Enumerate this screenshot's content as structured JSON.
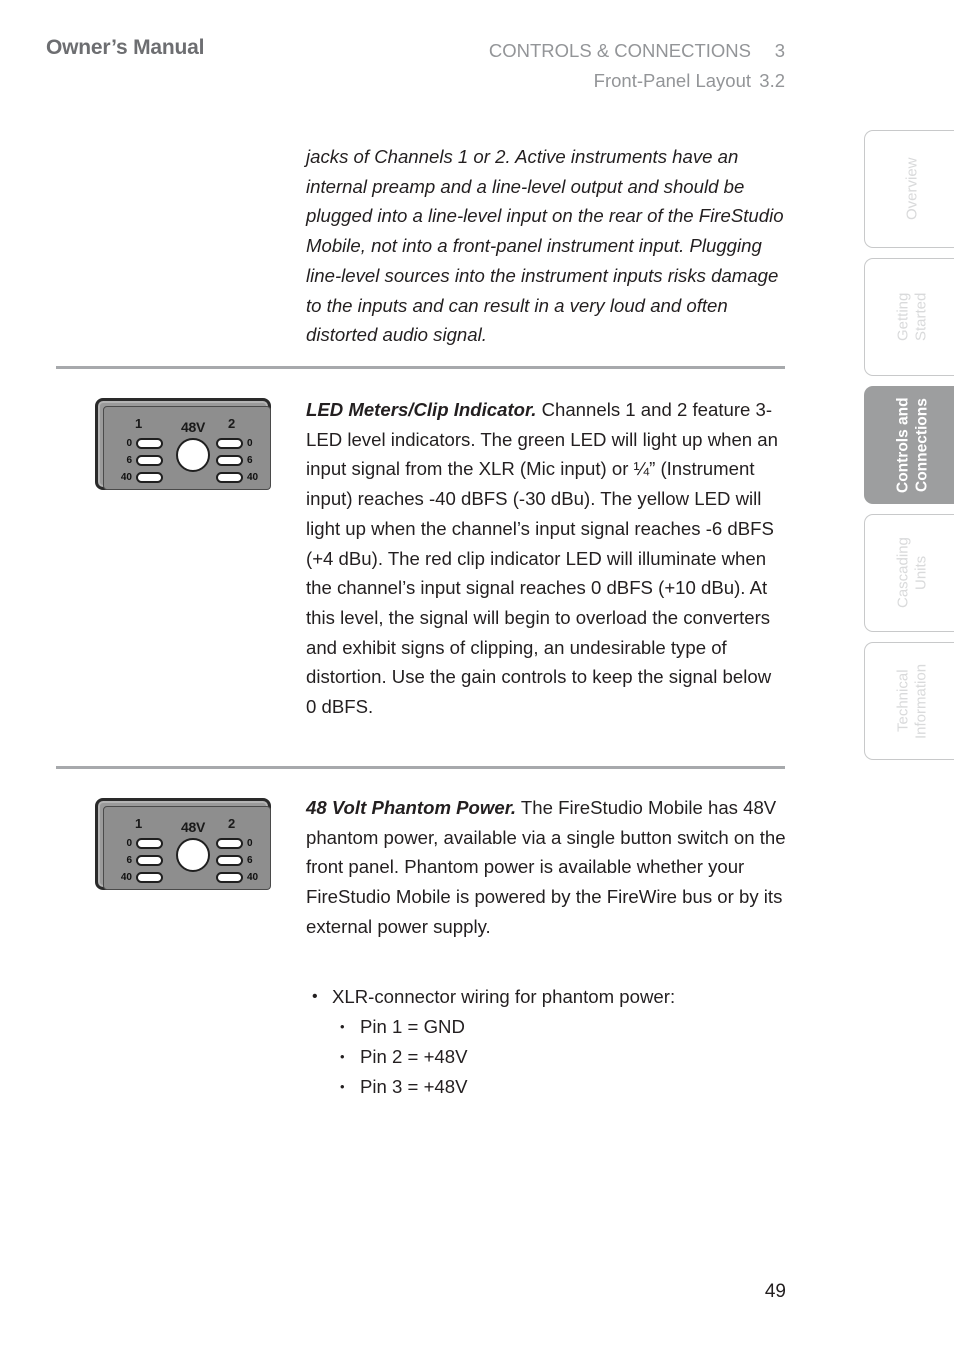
{
  "header": {
    "title": "Owner’s Manual",
    "section": "CONTROLS & CONNECTIONS",
    "section_number": "3",
    "subsection": "Front-Panel Layout",
    "subsection_number": "3.2"
  },
  "side_tabs": [
    {
      "label": "Overview",
      "active": false
    },
    {
      "label": "Getting\nStarted",
      "active": false
    },
    {
      "label": "Controls and\nConnections",
      "active": true
    },
    {
      "label": "Cascading\nUnits",
      "active": false
    },
    {
      "label": "Technical\nInformation",
      "active": false
    }
  ],
  "content": {
    "intro_paragraph": "jacks of Channels 1 or 2. Active instruments have an internal preamp and a line-level output and should be plugged into a line-level input on the rear of the FireStudio Mobile, not into a front-panel instrument input. Plugging line-level sources into the instrument inputs risks damage to the inputs and can result in a very loud and often distorted audio signal.",
    "led_section": {
      "lead": "LED Meters/Clip Indicator.",
      "body": " Channels 1 and 2 feature 3-LED level indicators. The green LED will light up when an input signal from the XLR (Mic input) or ¼” (Instrument input) reaches -40 dBFS (-30 dBu). The yellow LED will light up when the channel’s input signal reaches -6 dBFS (+4 dBu). The red clip indicator LED will illuminate when the channel’s input signal reaches 0 dBFS (+10 dBu). At this level, the signal will begin to overload the converters and exhibit signs of clipping, an undesirable type of distortion. Use the gain controls to keep the signal below 0 dBFS."
    },
    "phantom_section": {
      "lead": "48 Volt Phantom Power.",
      "body": " The FireStudio Mobile has 48V phantom power, available via a single button switch on the front panel. Phantom power is available whether your FireStudio Mobile is powered by the FireWire bus or by its external power supply."
    },
    "bullets": {
      "level1": "XLR-connector wiring for phantom power:",
      "level2": [
        "Pin 1 = GND",
        "Pin 2 = +48V",
        "Pin 3 = +48V"
      ]
    }
  },
  "panel_figure": {
    "channel_1_label": "1",
    "channel_2_label": "2",
    "phantom_label": "48V",
    "led_labels": [
      "0",
      "6",
      "40"
    ]
  },
  "footer": {
    "page_number": "49"
  },
  "colors": {
    "header_title": "#6d6e71",
    "header_right": "#939598",
    "rule": "#a7a9ac",
    "active_tab_bg": "#9d9e9f",
    "inactive_tab_border": "#c8c9ca",
    "inactive_tab_text": "#d9dadb",
    "panel_face": "#9a9a9a",
    "body_text": "#231f20"
  }
}
